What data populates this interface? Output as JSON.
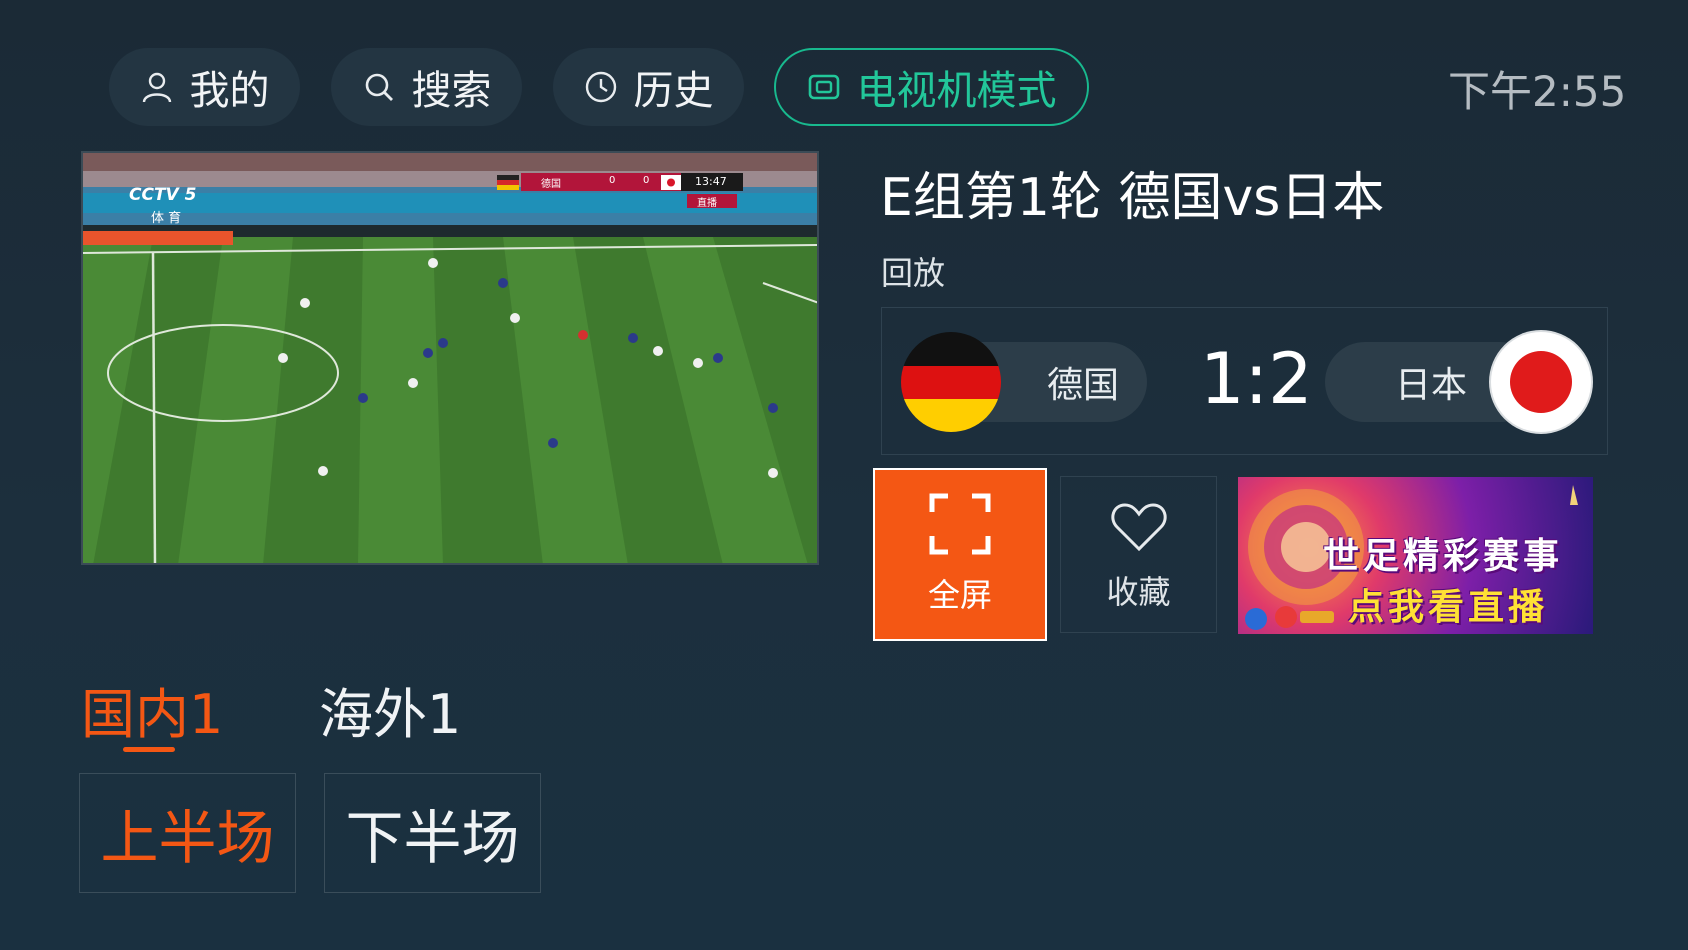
{
  "nav": {
    "mine": "我的",
    "search": "搜索",
    "history": "历史",
    "tv_mode": "电视机模式"
  },
  "clock": "下午2:55",
  "video": {
    "channel_logo": "CCTV 5",
    "channel_sub": "体 育",
    "scoreboard": {
      "home": "德国",
      "home_score": "0",
      "away_score": "0",
      "away": "日本",
      "time": "13:47",
      "live": "直播"
    }
  },
  "match": {
    "title": "E组第1轮 德国vs日本",
    "status": "回放",
    "home_team": "德国",
    "away_team": "日本",
    "score": "1:2"
  },
  "actions": {
    "fullscreen": "全屏",
    "favorite": "收藏"
  },
  "ad": {
    "line1": "世足精彩赛事",
    "line2": "点我看直播"
  },
  "sources": [
    "国内1",
    "海外1"
  ],
  "halves": [
    "上半场",
    "下半场"
  ],
  "colors": {
    "accent": "#f45714",
    "tv_mode": "#22c79a",
    "background": "#1c2f3d"
  }
}
